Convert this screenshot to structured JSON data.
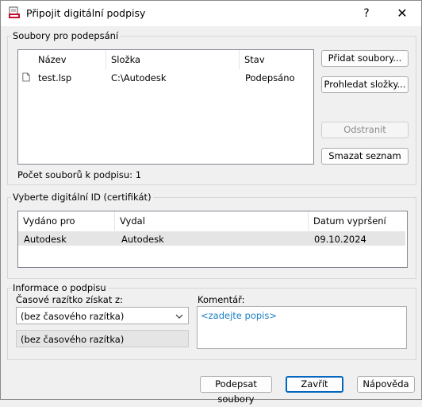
{
  "window": {
    "title": "Připojit digitální podpisy",
    "help_glyph": "?",
    "close_glyph": "✕"
  },
  "files_group": {
    "legend": "Soubory pro podepsání",
    "columns": [
      "Název",
      "Složka",
      "Stav"
    ],
    "rows": [
      {
        "name": "test.lsp",
        "folder": "C:\\Autodesk",
        "status": "Podepsáno"
      }
    ],
    "buttons": {
      "add_files": "Přidat soubory...",
      "browse_folders": "Prohledat složky...",
      "remove": "Odstranit",
      "clear_list": "Smazat seznam"
    },
    "count_label": "Počet souborů k podpisu: 1"
  },
  "cert_group": {
    "legend": "Vyberte digitální ID (certifikát)",
    "columns": [
      "Vydáno pro",
      "Vydal",
      "Datum vypršení"
    ],
    "rows": [
      {
        "issued_to": "Autodesk",
        "issued_by": "Autodesk",
        "expires": "09.10.2024"
      }
    ]
  },
  "sig_group": {
    "legend": "Informace o podpisu",
    "timestamp_label": "Časové razítko získat z:",
    "timestamp_value": "(bez časového razítka)",
    "timestamp_readonly": "(bez časového razítka)",
    "comment_label": "Komentář:",
    "comment_placeholder": "<zadejte popis>"
  },
  "footer": {
    "sign_files": "Podepsat soubory",
    "close": "Zavřít",
    "help": "Nápověda"
  },
  "colors": {
    "accent": "#0067c0",
    "placeholder": "#1a7fc4",
    "selected_row": "#e5e5e5"
  },
  "icons": [
    "app-signature-icon",
    "document-icon",
    "chevron-down-icon"
  ]
}
